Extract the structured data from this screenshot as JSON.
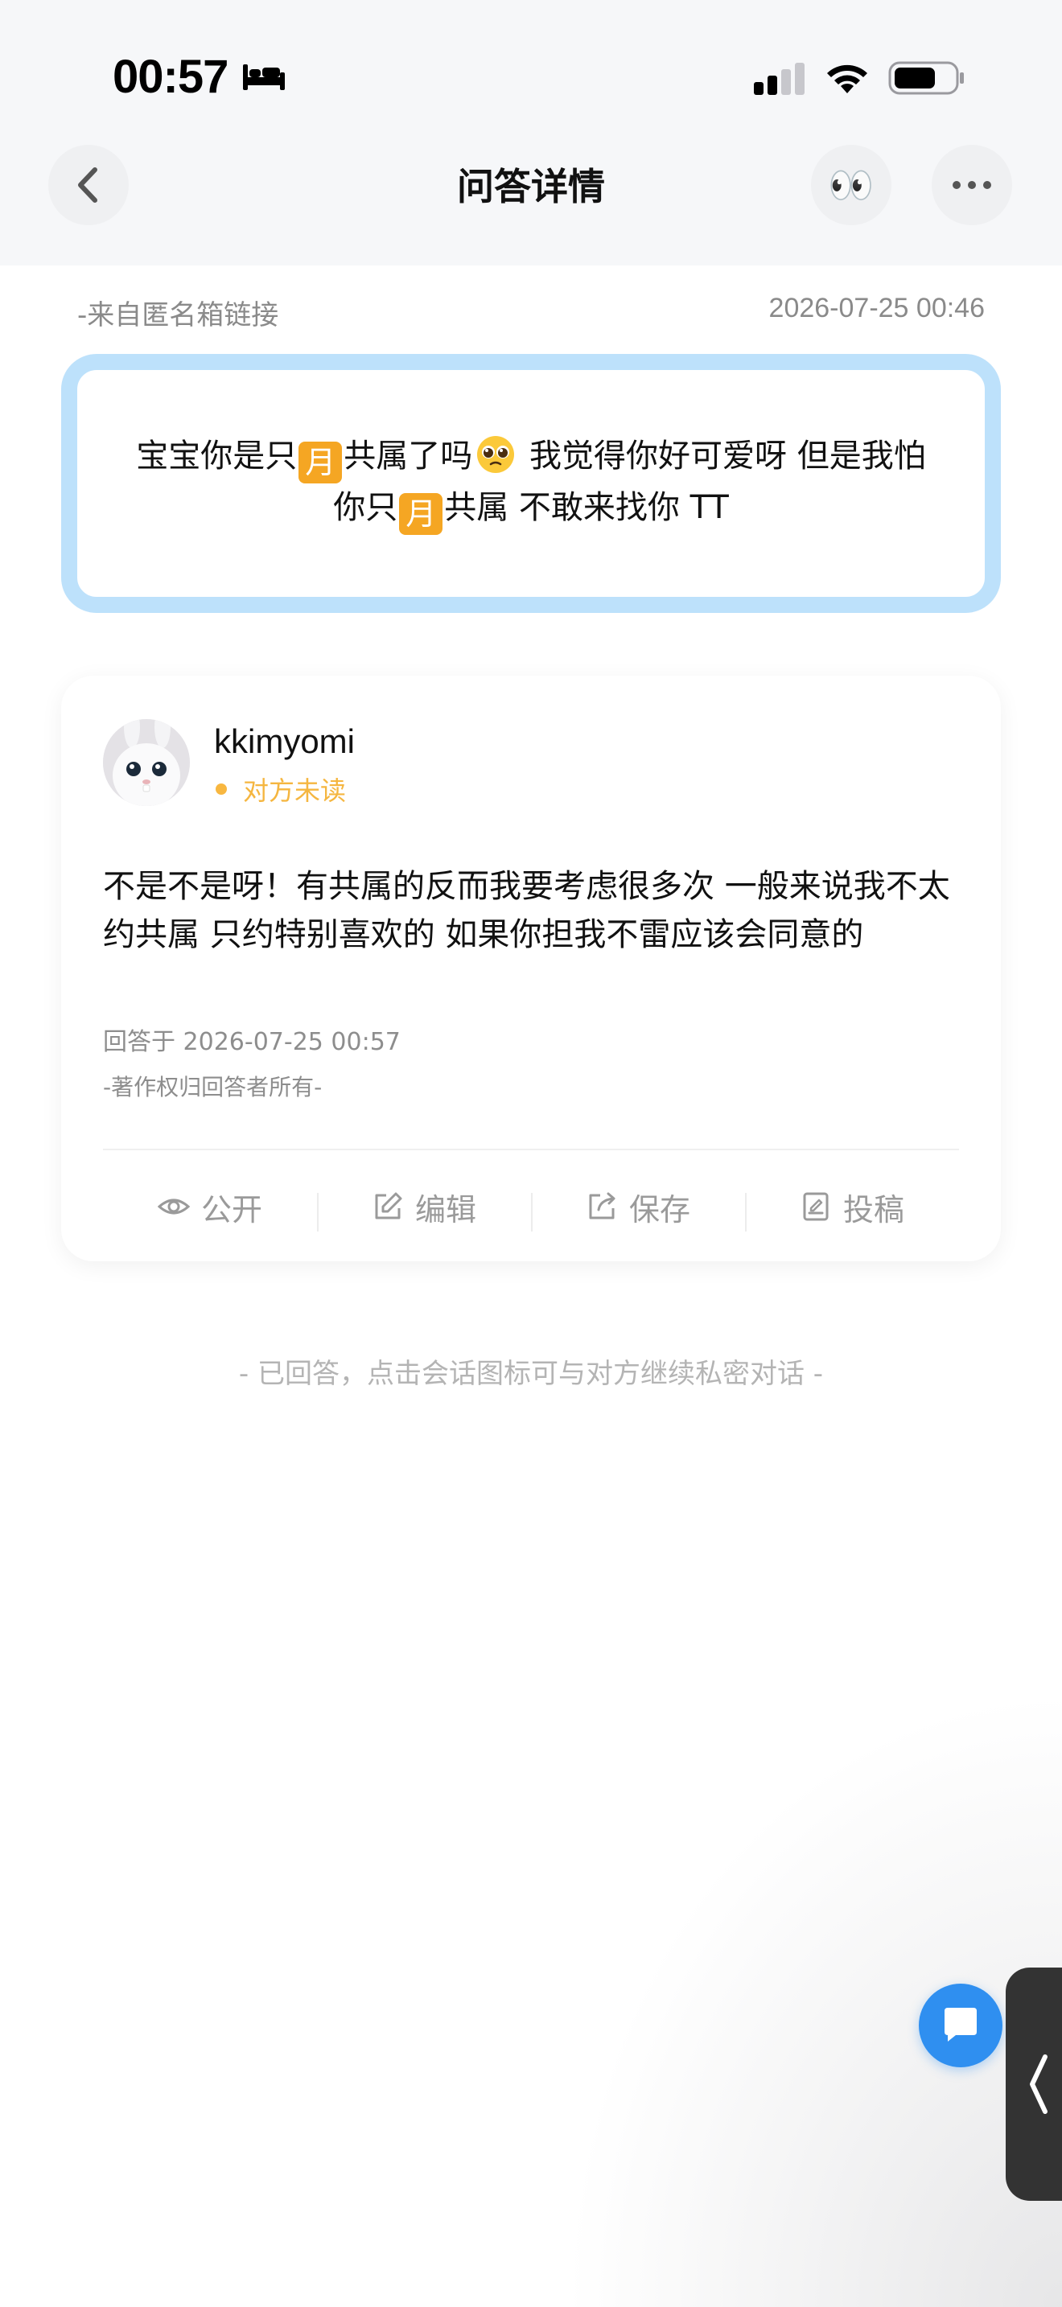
{
  "status_bar": {
    "time": "00:57"
  },
  "header": {
    "title": "问答详情",
    "eyes_emoji": "👀"
  },
  "question": {
    "source": "-来自匿名箱链接",
    "timestamp": "2026-07-25 00:46",
    "line1_a": "宝宝你是只",
    "badge": "月",
    "line1_b": "共属了吗",
    "line1_c": " 我觉得你好可爱呀 但是我怕",
    "line2_a": "你只",
    "line2_b": "共属 不敢来找你 TT"
  },
  "answer": {
    "username": "kkimyomi",
    "read_status": "对方未读",
    "text": "不是不是呀！有共属的反而我要考虑很多次 一般来说我不太约共属 只约特别喜欢的 如果你担我不雷应该会同意的",
    "answered_at": "回答于 2026-07-25 00:57",
    "copyright": "-著作权归回答者所有-",
    "actions": [
      {
        "label": "公开",
        "icon": "eye-icon"
      },
      {
        "label": "编辑",
        "icon": "edit-icon"
      },
      {
        "label": "保存",
        "icon": "share-icon"
      },
      {
        "label": "投稿",
        "icon": "document-icon"
      }
    ]
  },
  "hint": "- 已回答，点击会话图标可与对方继续私密对话 -",
  "colors": {
    "accent_blue": "#2f8ff0",
    "question_border": "#bde1fb",
    "unread_orange": "#f5b640"
  }
}
